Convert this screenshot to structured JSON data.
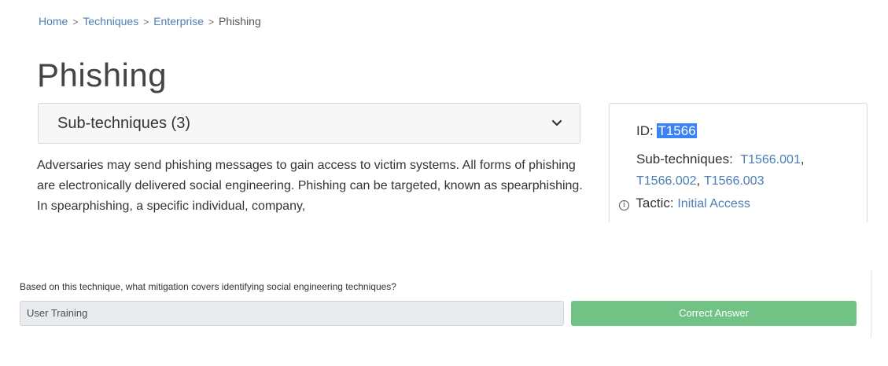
{
  "breadcrumb": {
    "items": [
      "Home",
      "Techniques",
      "Enterprise"
    ],
    "current": "Phishing",
    "separator": ">"
  },
  "page": {
    "title": "Phishing"
  },
  "subtechniques_card": {
    "label": "Sub-techniques (3)",
    "icon": "chevron-down-icon"
  },
  "description": "Adversaries may send phishing messages to gain access to victim systems. All forms of phishing are electronically delivered social engineering. Phishing can be targeted, known as spearphishing. In spearphishing, a specific individual, company,",
  "sidebar": {
    "id_label": "ID:",
    "id_value": "T1566",
    "subtech_label": "Sub-techniques:",
    "subtech_links": [
      "T1566.001",
      "T1566.002",
      "T1566.003"
    ],
    "tactic_label": "Tactic:",
    "tactic_value": "Initial Access",
    "info_icon": "ⓘ"
  },
  "quiz": {
    "question": "Based on this technique, what mitigation covers identifying social engineering techniques?",
    "answer": "User Training",
    "button_label": "Correct Answer"
  },
  "colors": {
    "link": "#4a7eb5",
    "highlight": "#3b82f6",
    "success_button": "#70c385"
  }
}
